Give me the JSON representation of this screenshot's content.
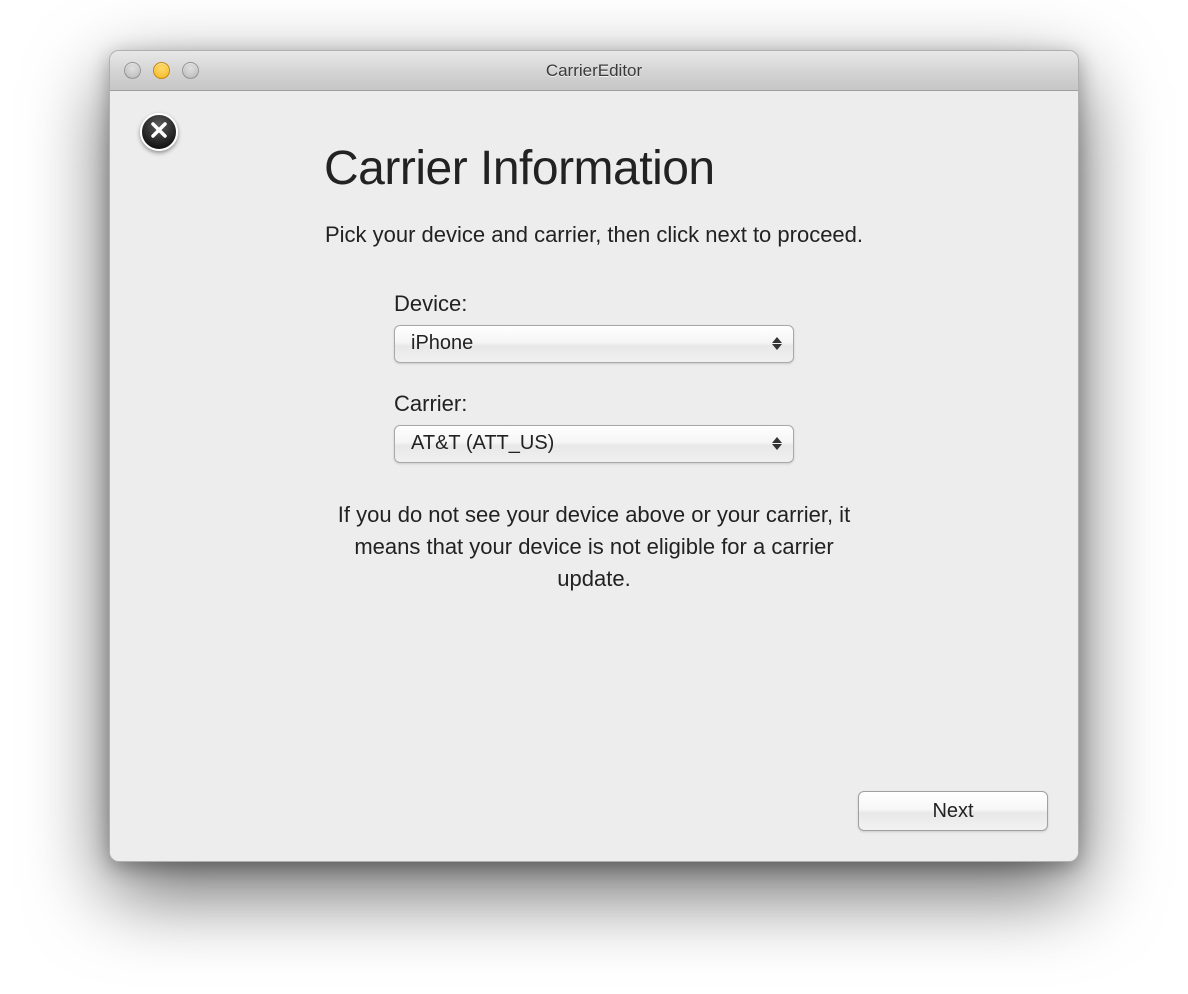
{
  "window": {
    "title": "CarrierEditor"
  },
  "page": {
    "heading": "Carrier Information",
    "subtitle": "Pick your device and carrier, then click next to proceed.",
    "device_label": "Device:",
    "device_value": "iPhone",
    "carrier_label": "Carrier:",
    "carrier_value": "AT&T (ATT_US)",
    "note": "If you do not see your device above or your carrier, it means that your device is not eligible for a carrier update.",
    "next_label": "Next"
  }
}
